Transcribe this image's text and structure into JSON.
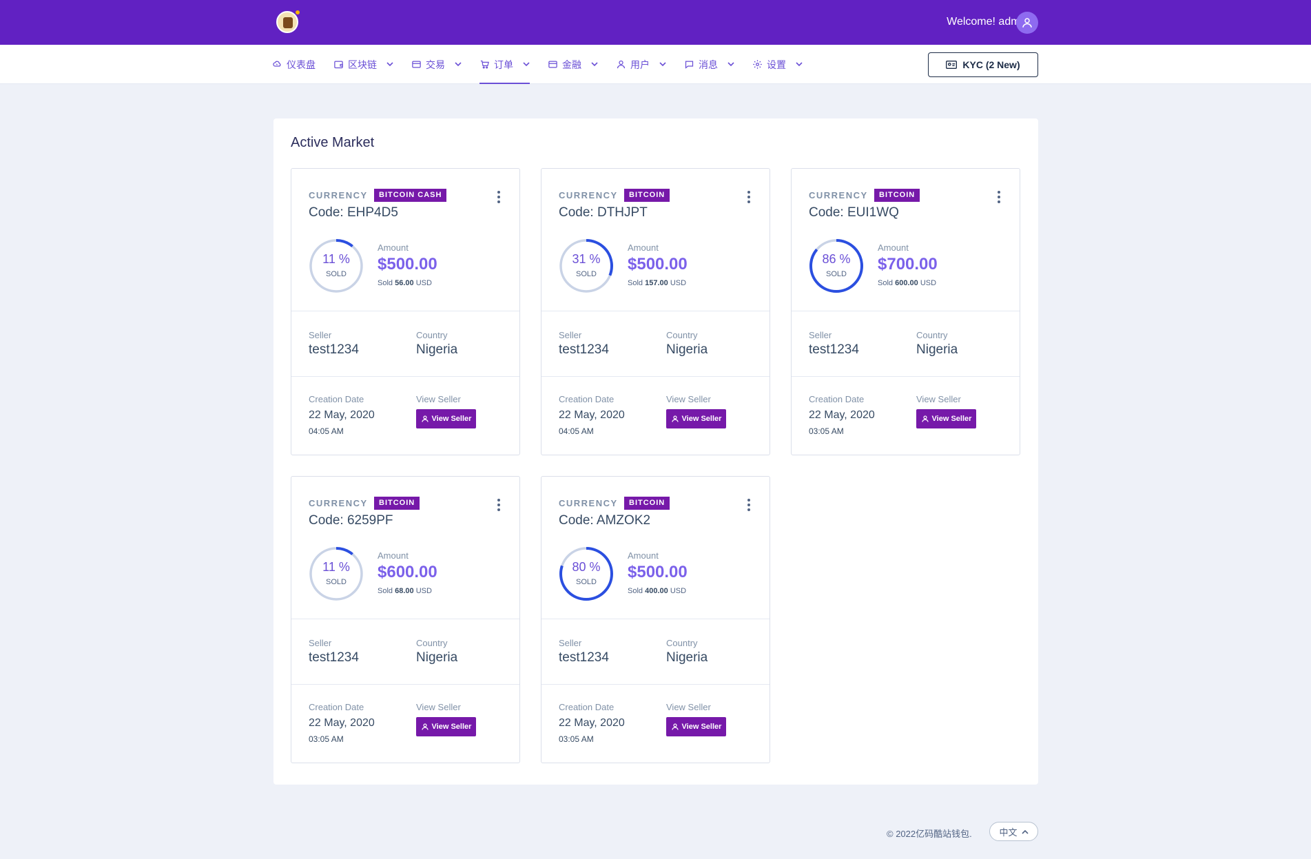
{
  "header": {
    "welcome": "Welcome! admin"
  },
  "nav": {
    "items": [
      {
        "label": "仪表盘",
        "icon": "cloud-icon",
        "dropdown": false,
        "active": false
      },
      {
        "label": "区块链",
        "icon": "wallet-icon",
        "dropdown": true,
        "active": false
      },
      {
        "label": "交易",
        "icon": "card-icon",
        "dropdown": true,
        "active": false
      },
      {
        "label": "订单",
        "icon": "cart-icon",
        "dropdown": true,
        "active": true
      },
      {
        "label": "金融",
        "icon": "card-icon",
        "dropdown": true,
        "active": false
      },
      {
        "label": "用户",
        "icon": "user-icon",
        "dropdown": true,
        "active": false
      },
      {
        "label": "消息",
        "icon": "chat-icon",
        "dropdown": true,
        "active": false
      },
      {
        "label": "设置",
        "icon": "gear-icon",
        "dropdown": true,
        "active": false
      }
    ],
    "kyc_label": "KYC (2 New)"
  },
  "main": {
    "title": "Active Market",
    "labels": {
      "currency": "CURRENCY",
      "amount": "Amount",
      "sold_prefix": "Sold",
      "sold_suffix": "USD",
      "sold_ring": "SOLD",
      "seller": "Seller",
      "country": "Country",
      "creation_date": "Creation Date",
      "view_seller": "View Seller",
      "view_seller_button": "View Seller"
    },
    "cards": [
      {
        "badge": "BITCOIN CASH",
        "code": "Code: EHP4D5",
        "percent": 11,
        "percent_text": "11 %",
        "amount": "$500.00",
        "sold_amount": "56.00",
        "seller": "test1234",
        "country": "Nigeria",
        "date": "22 May, 2020",
        "time": "04:05 AM"
      },
      {
        "badge": "BITCOIN",
        "code": "Code: DTHJPT",
        "percent": 31,
        "percent_text": "31 %",
        "amount": "$500.00",
        "sold_amount": "157.00",
        "seller": "test1234",
        "country": "Nigeria",
        "date": "22 May, 2020",
        "time": "04:05 AM"
      },
      {
        "badge": "BITCOIN",
        "code": "Code: EUI1WQ",
        "percent": 86,
        "percent_text": "86 %",
        "amount": "$700.00",
        "sold_amount": "600.00",
        "seller": "test1234",
        "country": "Nigeria",
        "date": "22 May, 2020",
        "time": "03:05 AM"
      },
      {
        "badge": "BITCOIN",
        "code": "Code: 6259PF",
        "percent": 11,
        "percent_text": "11 %",
        "amount": "$600.00",
        "sold_amount": "68.00",
        "seller": "test1234",
        "country": "Nigeria",
        "date": "22 May, 2020",
        "time": "03:05 AM"
      },
      {
        "badge": "BITCOIN",
        "code": "Code: AMZOK2",
        "percent": 80,
        "percent_text": "80 %",
        "amount": "$500.00",
        "sold_amount": "400.00",
        "seller": "test1234",
        "country": "Nigeria",
        "date": "22 May, 2020",
        "time": "03:05 AM"
      }
    ]
  },
  "footer": {
    "copyright": "© 2022亿码酷站钱包.",
    "language": "中文"
  },
  "colors": {
    "topbar": "#6121c2",
    "accent": "#6a4fd6",
    "badge": "#7619a9",
    "ring_progress": "#2b4fe0",
    "ring_track": "#c9d3e6"
  }
}
